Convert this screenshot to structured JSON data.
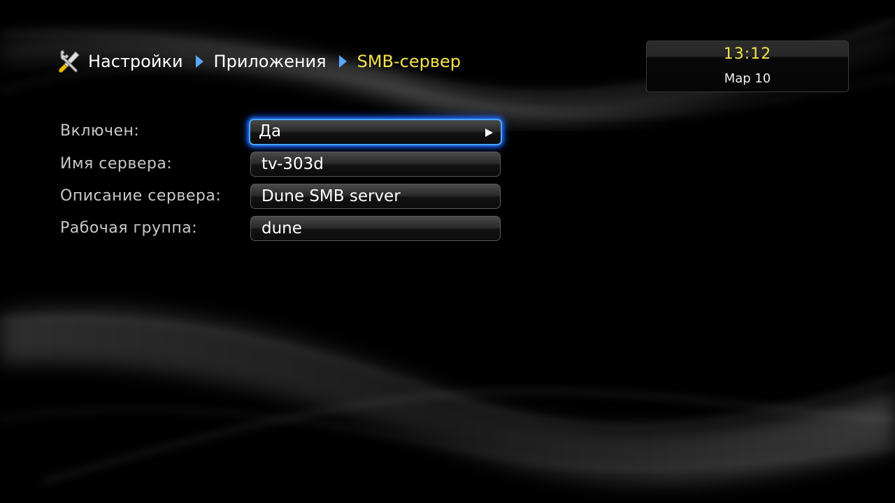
{
  "breadcrumb": {
    "icon": "tools-icon",
    "items": [
      "Настройки",
      "Приложения",
      "SMB-сервер"
    ],
    "current_color": "#f4e34a",
    "separator_color": "#5aa9ff"
  },
  "clock": {
    "time": "13:12",
    "date": "Мар 10",
    "time_color": "#f4e34a"
  },
  "settings": {
    "focus_color": "#4aa8ff",
    "rows": [
      {
        "label": "Включен:",
        "value": "Да",
        "focused": true,
        "has_arrow": true
      },
      {
        "label": "Имя сервера:",
        "value": "tv-303d"
      },
      {
        "label": "Описание сервера:",
        "value": "Dune SMB server"
      },
      {
        "label": "Рабочая группа:",
        "value": "dune"
      }
    ]
  }
}
